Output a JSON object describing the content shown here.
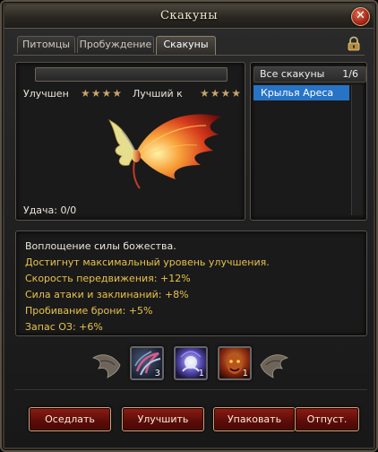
{
  "window": {
    "title": "Скакуны"
  },
  "tabs": [
    {
      "label": "Питомцы"
    },
    {
      "label": "Пробуждение"
    },
    {
      "label": "Скакуны"
    }
  ],
  "mount": {
    "upgraded_label": "Улучшен",
    "upgraded_stars": "★★★★",
    "best_label": "Лучший к",
    "best_stars": "★★★★",
    "luck_text": "Удача: 0/0",
    "star_level_current": 4,
    "star_level_best": 4
  },
  "list": {
    "header": "Все скакуны",
    "count": "1/6",
    "items": [
      {
        "label": "Крылья Ареса"
      }
    ]
  },
  "description": {
    "lines": [
      "Воплощение силы божества.",
      "Достигнут максимальный уровень улучшения.",
      "Скорость передвижения: +12%",
      "Сила атаки и заклинаний: +8%",
      "Пробивание брони: +5%",
      "Запас ОЗ: +6%"
    ]
  },
  "slots": [
    {
      "icon": "claw-icon",
      "count": "3"
    },
    {
      "icon": "spirit-icon",
      "count": "1"
    },
    {
      "icon": "beast-icon",
      "count": "1"
    }
  ],
  "buttons": {
    "saddle": "Оседлать",
    "upgrade": "Улучшить",
    "pack": "Упаковать",
    "release": "Отпуст."
  },
  "colors": {
    "accent_selected": "#2774c6",
    "text_yellow": "#e7c34d",
    "button_red": "#7a150f",
    "stars": "#c7a56a"
  }
}
